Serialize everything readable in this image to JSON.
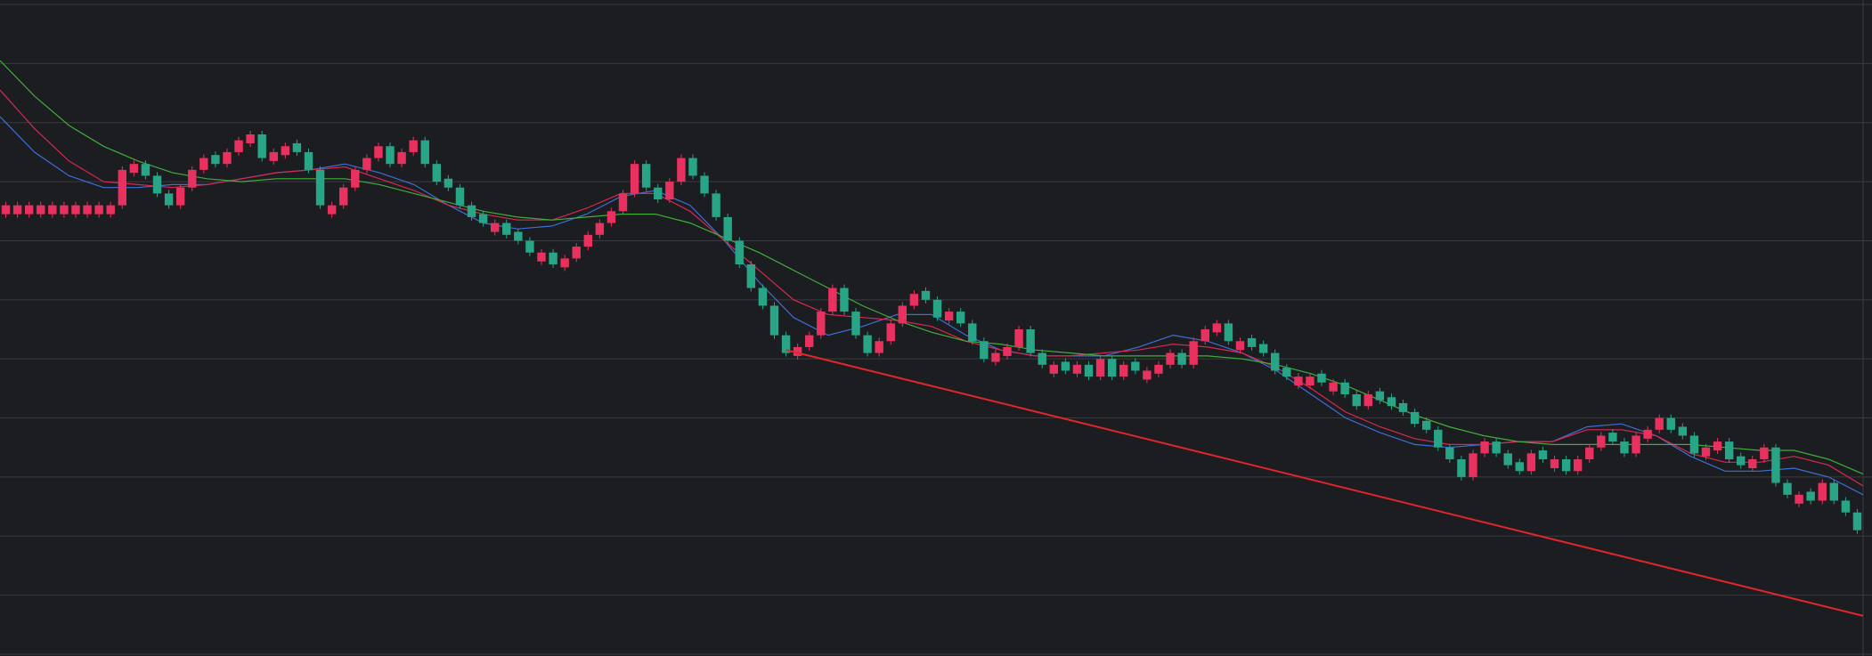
{
  "chart_data": {
    "type": "candlestick",
    "style": "renko",
    "title": "",
    "xlabel": "",
    "ylabel": "",
    "ylim": [
      0,
      11
    ],
    "grid": "horizontal",
    "legend": "none",
    "colors": {
      "background": "#1c1d21",
      "grid": "#3a3b41",
      "up": "#e8315e",
      "down": "#27a586",
      "ma_fast": "#3b6fd8",
      "ma_mid": "#d8284f",
      "ma_slow": "#3fae3a",
      "trendline": "#e0262d"
    },
    "close_levels": [
      7.6,
      7.6,
      7.6,
      7.6,
      7.6,
      7.6,
      7.6,
      7.6,
      7.6,
      7.6,
      8.2,
      8.3,
      8.1,
      7.8,
      7.6,
      7.9,
      8.2,
      8.4,
      8.3,
      8.5,
      8.7,
      8.8,
      8.4,
      8.5,
      8.6,
      8.5,
      8.2,
      7.6,
      7.6,
      7.9,
      8.2,
      8.4,
      8.6,
      8.3,
      8.5,
      8.7,
      8.3,
      8.0,
      7.9,
      7.6,
      7.4,
      7.3,
      7.3,
      7.1,
      7.0,
      6.8,
      6.8,
      6.6,
      6.7,
      6.9,
      7.1,
      7.3,
      7.5,
      7.8,
      8.3,
      7.9,
      7.7,
      8.0,
      8.4,
      8.1,
      7.8,
      7.4,
      7.0,
      6.6,
      6.2,
      5.9,
      5.4,
      5.1,
      5.2,
      5.4,
      5.8,
      6.2,
      5.8,
      5.4,
      5.1,
      5.3,
      5.6,
      5.9,
      6.1,
      6.0,
      5.7,
      5.8,
      5.6,
      5.3,
      5.0,
      5.1,
      5.2,
      5.5,
      5.1,
      4.9,
      4.9,
      4.8,
      4.9,
      4.7,
      5.0,
      4.7,
      4.9,
      4.8,
      4.8,
      4.9,
      5.1,
      4.9,
      5.3,
      5.5,
      5.6,
      5.3,
      5.3,
      5.2,
      5.1,
      4.8,
      4.7,
      4.7,
      4.7,
      4.6,
      4.6,
      4.4,
      4.2,
      4.4,
      4.3,
      4.2,
      4.1,
      3.9,
      3.8,
      3.5,
      3.3,
      3.0,
      3.4,
      3.6,
      3.4,
      3.2,
      3.1,
      3.4,
      3.3,
      3.3,
      3.1,
      3.3,
      3.5,
      3.7,
      3.6,
      3.4,
      3.7,
      3.8,
      4.0,
      3.8,
      3.7,
      3.4,
      3.5,
      3.6,
      3.3,
      3.2,
      3.3,
      3.5,
      2.9,
      2.7,
      2.7,
      2.6,
      2.9,
      2.6,
      2.4,
      2.1
    ],
    "moving_averages": [
      {
        "color": "#3b6fd8",
        "values": [
          9.1,
          8.5,
          8.1,
          7.9,
          7.9,
          7.95,
          7.95,
          8.05,
          8.15,
          8.2,
          8.3,
          8.15,
          7.95,
          7.6,
          7.3,
          7.2,
          7.25,
          7.45,
          7.75,
          7.85,
          7.6,
          7.0,
          6.3,
          5.7,
          5.4,
          5.55,
          5.75,
          5.75,
          5.4,
          5.15,
          5.05,
          5.05,
          5.05,
          5.2,
          5.4,
          5.3,
          5.1,
          4.8,
          4.4,
          4.0,
          3.75,
          3.55,
          3.5,
          3.55,
          3.6,
          3.6,
          3.85,
          3.9,
          3.7,
          3.35,
          3.1,
          3.1,
          3.15,
          3.0,
          2.7
        ]
      },
      {
        "color": "#d8284f",
        "values": [
          9.55,
          8.9,
          8.35,
          8.0,
          7.95,
          7.9,
          7.95,
          8.05,
          8.15,
          8.2,
          8.25,
          8.05,
          7.85,
          7.6,
          7.45,
          7.35,
          7.35,
          7.55,
          7.8,
          7.8,
          7.5,
          7.0,
          6.5,
          6.0,
          5.75,
          5.7,
          5.65,
          5.55,
          5.3,
          5.15,
          5.05,
          5.05,
          5.1,
          5.15,
          5.25,
          5.2,
          5.1,
          4.85,
          4.5,
          4.1,
          3.85,
          3.65,
          3.55,
          3.55,
          3.6,
          3.6,
          3.8,
          3.8,
          3.7,
          3.4,
          3.25,
          3.25,
          3.35,
          3.2,
          2.85
        ]
      },
      {
        "color": "#3fae3a",
        "values": [
          10.05,
          9.45,
          8.95,
          8.6,
          8.35,
          8.15,
          8.05,
          8.0,
          8.05,
          8.05,
          8.05,
          7.95,
          7.8,
          7.65,
          7.5,
          7.4,
          7.35,
          7.4,
          7.45,
          7.45,
          7.3,
          7.05,
          6.8,
          6.5,
          6.2,
          5.9,
          5.65,
          5.45,
          5.3,
          5.25,
          5.15,
          5.1,
          5.05,
          5.05,
          5.05,
          5.05,
          5.0,
          4.9,
          4.75,
          4.55,
          4.3,
          4.05,
          3.85,
          3.7,
          3.6,
          3.55,
          3.55,
          3.55,
          3.55,
          3.55,
          3.5,
          3.45,
          3.45,
          3.3,
          3.05
        ]
      }
    ],
    "trendline": {
      "color": "#e0262d",
      "from": [
        67,
        5.15
      ],
      "to": [
        159,
        0.65
      ]
    }
  }
}
